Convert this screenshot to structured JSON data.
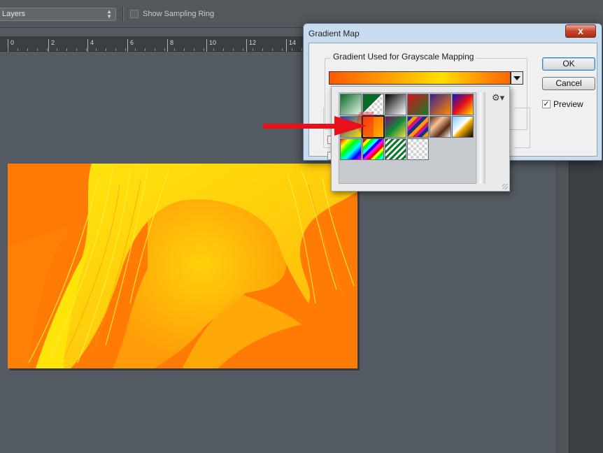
{
  "options_bar": {
    "sample_select_value": "Layers",
    "sampling_ring_label": "Show Sampling Ring",
    "sampling_ring_checked": false
  },
  "ruler": {
    "labels": [
      "0",
      "2",
      "4",
      "6",
      "8",
      "10",
      "12",
      "14"
    ]
  },
  "dialog": {
    "title": "Gradient Map",
    "close_label": "x",
    "group_title": "Gradient Used for Grayscale Mapping",
    "ok_label": "OK",
    "cancel_label": "Cancel",
    "preview_label": "Preview",
    "preview_checked": true,
    "current_gradient": "orange-yellow"
  },
  "picker": {
    "gear_icon": "gear-icon",
    "selected_swatch": "orange-yellow"
  },
  "colors": {
    "workspace_bg": "#535a61",
    "dialog_frame": "#c9dcee",
    "image_orange": "#ff7d06",
    "image_yellow": "#ffe40a",
    "arrow_red": "#e8101a"
  }
}
